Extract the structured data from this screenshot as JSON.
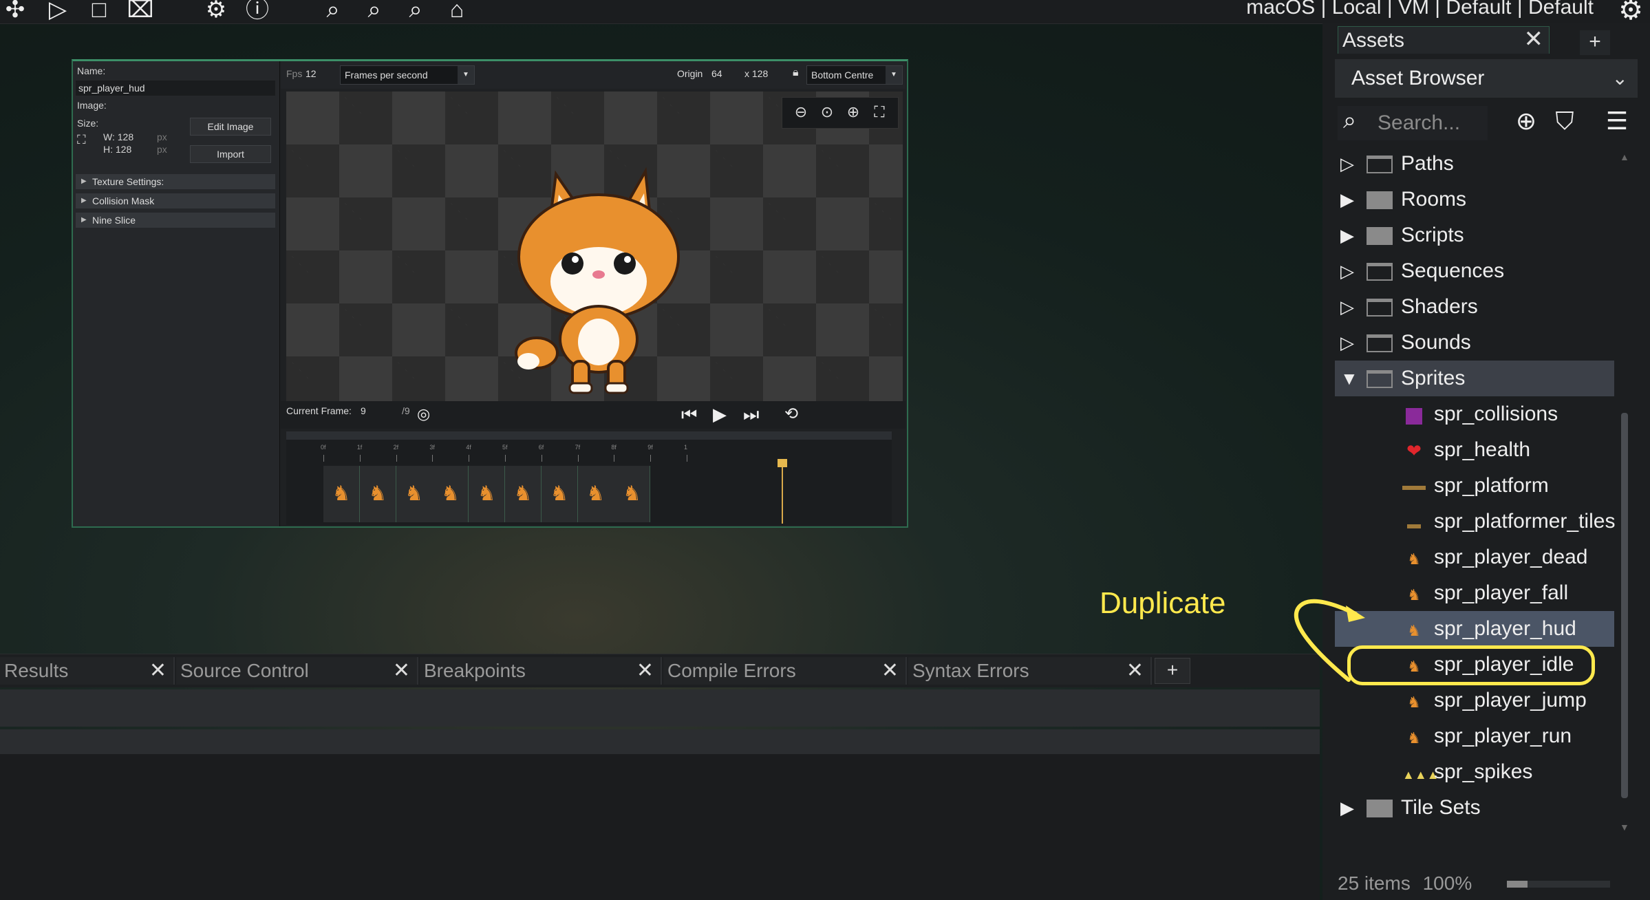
{
  "toolbar": {
    "target_text": "macOS | Local | VM | Default | Default",
    "icons": [
      "build-icon",
      "play-icon",
      "stop-icon",
      "clean-icon",
      "settings-icon",
      "info-icon",
      "zoom-out-icon",
      "zoom-reset-icon",
      "zoom-in-icon",
      "device-icon",
      "gear-icon"
    ]
  },
  "sprite_editor": {
    "name_label": "Name:",
    "name_value": "spr_player_hud",
    "image_label": "Image:",
    "size_label": "Size:",
    "width": "W: 128",
    "height": "H: 128",
    "px_unit": "px",
    "edit_image_button": "Edit Image",
    "import_button": "Import",
    "sections": [
      "Texture Settings:",
      "Collision Mask",
      "Nine Slice"
    ],
    "fps_label": "Fps",
    "fps_value": "12",
    "fps_mode": "Frames per second",
    "origin_label": "Origin",
    "origin_x": "64",
    "origin_y_label": "x 128",
    "origin_preset": "Bottom Centre",
    "current_frame_label": "Current Frame:",
    "current_frame": "9",
    "total_frames": "/9",
    "timeline_ticks": [
      "0f",
      "1f",
      "2f",
      "3f",
      "4f",
      "5f",
      "6f",
      "7f",
      "8f",
      "9f",
      "1"
    ],
    "frame_count": 9
  },
  "output_tabs": [
    {
      "label": "Results"
    },
    {
      "label": "Source Control"
    },
    {
      "label": "Breakpoints"
    },
    {
      "label": "Compile Errors"
    },
    {
      "label": "Syntax Errors"
    }
  ],
  "output_add": "+",
  "assets": {
    "tab_label": "Assets",
    "tab_add": "+",
    "header": "Asset Browser",
    "search_placeholder": "Search...",
    "tree": [
      {
        "label": "Paths",
        "type": "folder",
        "expanded": false,
        "solid": false
      },
      {
        "label": "Rooms",
        "type": "folder",
        "expanded": false,
        "solid": true
      },
      {
        "label": "Scripts",
        "type": "folder",
        "expanded": false,
        "solid": true
      },
      {
        "label": "Sequences",
        "type": "folder",
        "expanded": false,
        "solid": false
      },
      {
        "label": "Shaders",
        "type": "folder",
        "expanded": false,
        "solid": false
      },
      {
        "label": "Sounds",
        "type": "folder",
        "expanded": false,
        "solid": false
      },
      {
        "label": "Sprites",
        "type": "folder",
        "expanded": true,
        "solid": false
      },
      {
        "label": "spr_collisions",
        "type": "sprite",
        "icon": "purple-square-icon"
      },
      {
        "label": "spr_health",
        "type": "sprite",
        "icon": "heart-icon"
      },
      {
        "label": "spr_platform",
        "type": "sprite",
        "icon": "platform-icon"
      },
      {
        "label": "spr_platformer_tiles",
        "type": "sprite",
        "icon": "tiles-icon"
      },
      {
        "label": "spr_player_dead",
        "type": "sprite",
        "icon": "fox-icon"
      },
      {
        "label": "spr_player_fall",
        "type": "sprite",
        "icon": "fox-icon"
      },
      {
        "label": "spr_player_hud",
        "type": "sprite",
        "icon": "fox-icon"
      },
      {
        "label": "spr_player_idle",
        "type": "sprite",
        "icon": "fox-icon"
      },
      {
        "label": "spr_player_jump",
        "type": "sprite",
        "icon": "fox-icon"
      },
      {
        "label": "spr_player_run",
        "type": "sprite",
        "icon": "fox-icon"
      },
      {
        "label": "spr_spikes",
        "type": "sprite",
        "icon": "spikes-icon"
      },
      {
        "label": "Tile Sets",
        "type": "folder",
        "expanded": false,
        "solid": true
      }
    ],
    "status_count": "25 items",
    "status_zoom": "100%"
  },
  "annotation": {
    "label": "Duplicate",
    "color": "#ffe94d"
  }
}
